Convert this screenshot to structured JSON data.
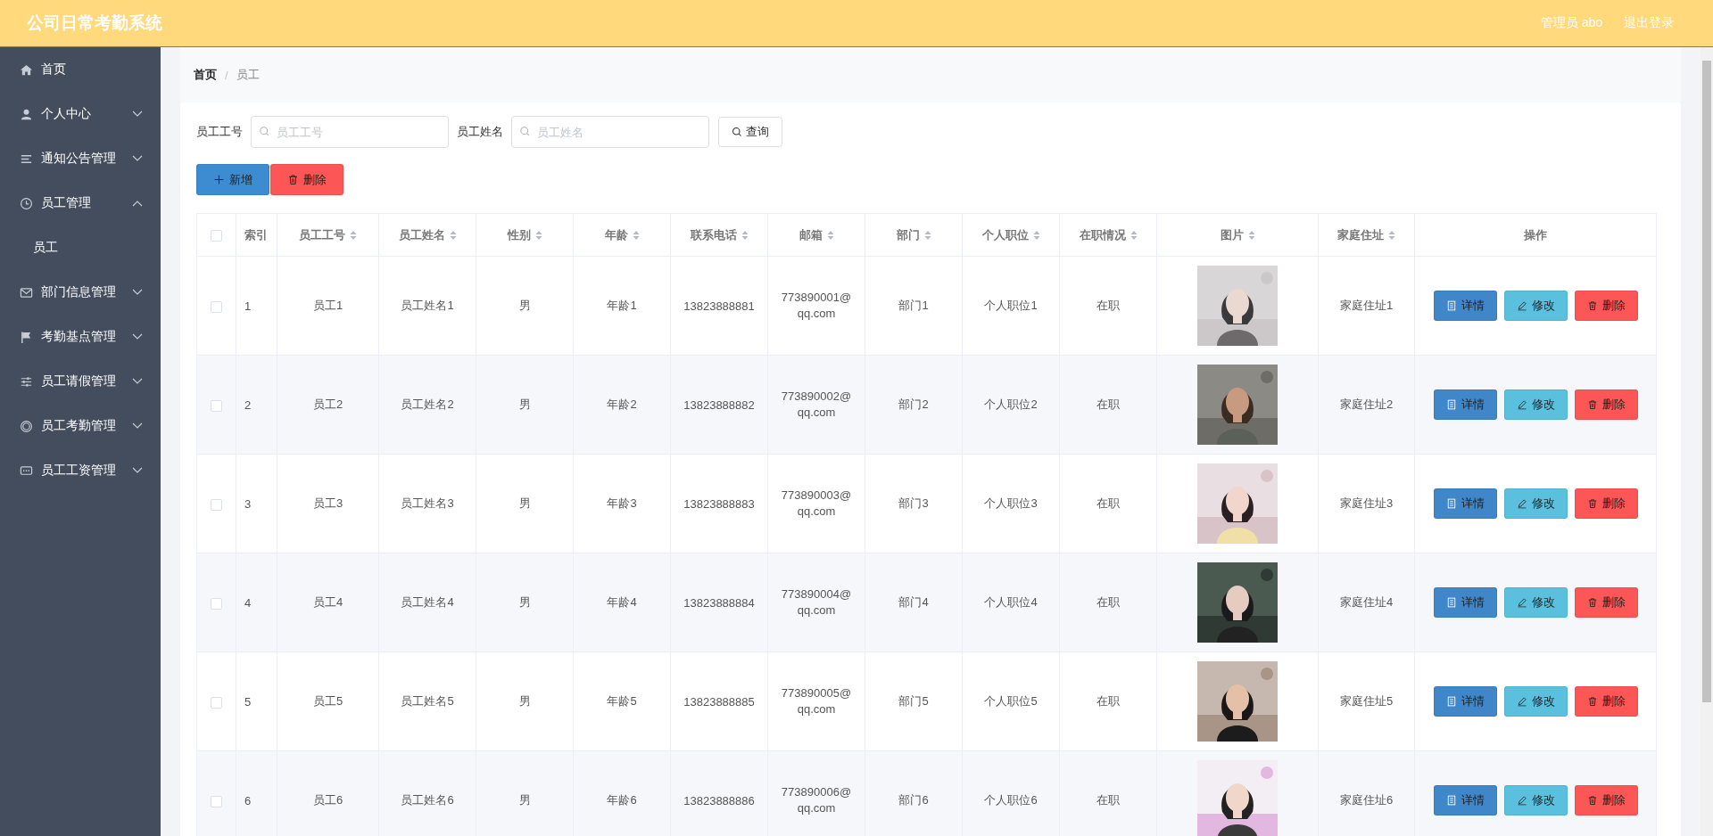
{
  "header": {
    "title": "公司日常考勤系统",
    "user": "管理员 abo",
    "logout": "退出登录"
  },
  "sidebar": {
    "items": [
      {
        "label": "首页",
        "kind": "link"
      },
      {
        "label": "个人中心",
        "kind": "menu",
        "expanded": false
      },
      {
        "label": "通知公告管理",
        "kind": "menu",
        "expanded": false
      },
      {
        "label": "员工管理",
        "kind": "menu",
        "expanded": true,
        "children": [
          {
            "label": "员工"
          }
        ]
      },
      {
        "label": "部门信息管理",
        "kind": "menu",
        "expanded": false
      },
      {
        "label": "考勤基点管理",
        "kind": "menu",
        "expanded": false
      },
      {
        "label": "员工请假管理",
        "kind": "menu",
        "expanded": false
      },
      {
        "label": "员工考勤管理",
        "kind": "menu",
        "expanded": false
      },
      {
        "label": "员工工资管理",
        "kind": "menu",
        "expanded": false
      }
    ]
  },
  "breadcrumb": {
    "items": [
      "首页",
      "员工"
    ],
    "separator": "/"
  },
  "search": {
    "fields": [
      {
        "label": "员工工号",
        "placeholder": "员工工号"
      },
      {
        "label": "员工姓名",
        "placeholder": "员工姓名"
      }
    ],
    "button": "查询"
  },
  "actions": [
    {
      "label": "新增",
      "kind": "add"
    },
    {
      "label": "删除",
      "kind": "delete"
    }
  ],
  "table": {
    "select_all": {
      "checked": false
    },
    "columns": [
      {
        "label": "索引",
        "sortable": false
      },
      {
        "label": "员工工号",
        "sortable": true
      },
      {
        "label": "员工姓名",
        "sortable": true
      },
      {
        "label": "性别",
        "sortable": true
      },
      {
        "label": "年龄",
        "sortable": true
      },
      {
        "label": "联系电话",
        "sortable": true
      },
      {
        "label": "邮箱",
        "sortable": true
      },
      {
        "label": "部门",
        "sortable": true
      },
      {
        "label": "个人职位",
        "sortable": true
      },
      {
        "label": "在职情况",
        "sortable": true
      },
      {
        "label": "图片",
        "sortable": true
      },
      {
        "label": "家庭住址",
        "sortable": true
      },
      {
        "label": "操作",
        "sortable": false
      }
    ],
    "rows": [
      {
        "checked": false,
        "cells": [
          "1",
          "员工1",
          "员工姓名1",
          "男",
          "年龄1",
          "13823888881",
          "773890001@qq.com",
          "部门1",
          "个人职位1",
          "在职"
        ],
        "address": "家庭住址1",
        "actions": [
          {
            "label": "详情",
            "kind": "detail"
          },
          {
            "label": "修改",
            "kind": "edit"
          },
          {
            "label": "删除",
            "kind": "delete"
          }
        ]
      },
      {
        "checked": false,
        "cells": [
          "2",
          "员工2",
          "员工姓名2",
          "男",
          "年龄2",
          "13823888882",
          "773890002@qq.com",
          "部门2",
          "个人职位2",
          "在职"
        ],
        "address": "家庭住址2",
        "actions": [
          {
            "label": "详情",
            "kind": "detail"
          },
          {
            "label": "修改",
            "kind": "edit"
          },
          {
            "label": "删除",
            "kind": "delete"
          }
        ]
      },
      {
        "checked": false,
        "cells": [
          "3",
          "员工3",
          "员工姓名3",
          "男",
          "年龄3",
          "13823888883",
          "773890003@qq.com",
          "部门3",
          "个人职位3",
          "在职"
        ],
        "address": "家庭住址3",
        "actions": [
          {
            "label": "详情",
            "kind": "detail"
          },
          {
            "label": "修改",
            "kind": "edit"
          },
          {
            "label": "删除",
            "kind": "delete"
          }
        ]
      },
      {
        "checked": false,
        "cells": [
          "4",
          "员工4",
          "员工姓名4",
          "男",
          "年龄4",
          "13823888884",
          "773890004@qq.com",
          "部门4",
          "个人职位4",
          "在职"
        ],
        "address": "家庭住址4",
        "actions": [
          {
            "label": "详情",
            "kind": "detail"
          },
          {
            "label": "修改",
            "kind": "edit"
          },
          {
            "label": "删除",
            "kind": "delete"
          }
        ]
      },
      {
        "checked": false,
        "cells": [
          "5",
          "员工5",
          "员工姓名5",
          "男",
          "年龄5",
          "13823888885",
          "773890005@qq.com",
          "部门5",
          "个人职位5",
          "在职"
        ],
        "address": "家庭住址5",
        "actions": [
          {
            "label": "详情",
            "kind": "detail"
          },
          {
            "label": "修改",
            "kind": "edit"
          },
          {
            "label": "删除",
            "kind": "delete"
          }
        ]
      },
      {
        "checked": false,
        "cells": [
          "6",
          "员工6",
          "员工姓名6",
          "男",
          "年龄6",
          "13823888886",
          "773890006@qq.com",
          "部门6",
          "个人职位6",
          "在职"
        ],
        "address": "家庭住址6",
        "actions": [
          {
            "label": "详情",
            "kind": "detail"
          },
          {
            "label": "修改",
            "kind": "edit"
          },
          {
            "label": "删除",
            "kind": "delete"
          }
        ]
      }
    ]
  }
}
